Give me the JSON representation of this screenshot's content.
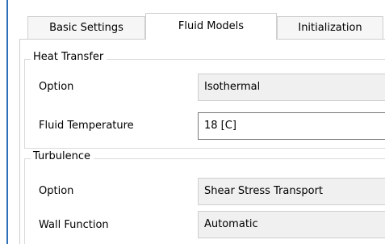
{
  "tabs": [
    {
      "label": "Basic Settings",
      "active": false
    },
    {
      "label": "Fluid Models",
      "active": true
    },
    {
      "label": "Initialization",
      "active": false
    }
  ],
  "heat_transfer": {
    "title": "Heat Transfer",
    "option": {
      "label": "Option",
      "value": "Isothermal"
    },
    "fluid_temperature": {
      "label": "Fluid Temperature",
      "value": "18 [C]"
    }
  },
  "turbulence": {
    "title": "Turbulence",
    "option": {
      "label": "Option",
      "value": "Shear Stress Transport"
    },
    "wall_function": {
      "label": "Wall Function",
      "value": "Automatic"
    }
  },
  "colors": {
    "accent_border": "#2d6fb8",
    "readonly_field": "#f0f0f0",
    "border": "#cfcfcf"
  }
}
